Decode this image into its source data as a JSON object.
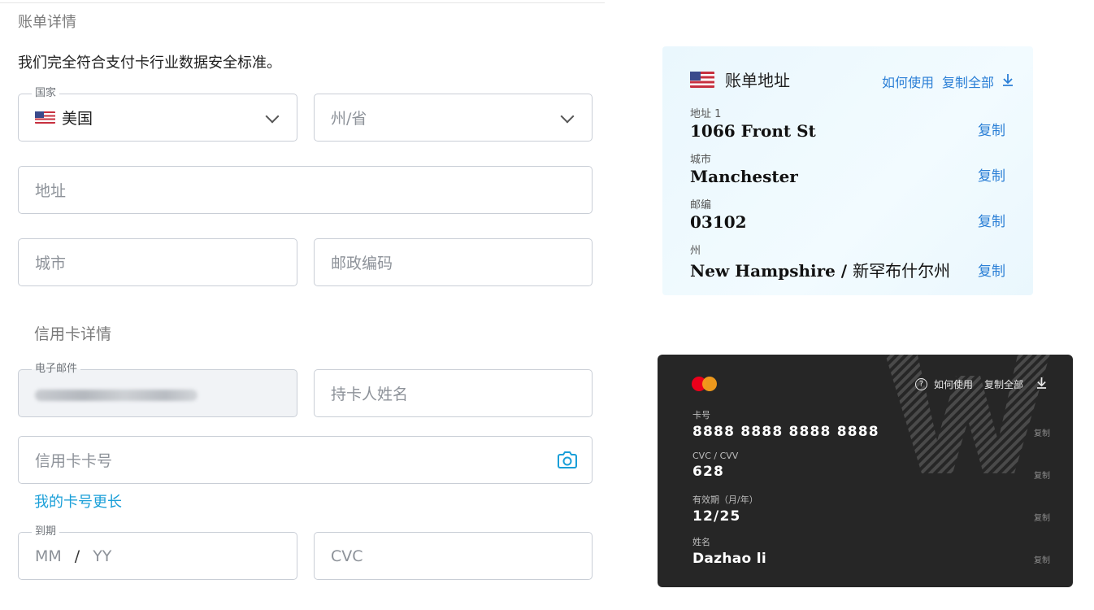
{
  "form": {
    "section_title": "账单详情",
    "subtitle": "我们完全符合支付卡行业数据安全标准。",
    "country_label": "国家",
    "country_value": "美国",
    "state_placeholder": "州/省",
    "address_placeholder": "地址",
    "city_placeholder": "城市",
    "postal_placeholder": "邮政编码",
    "cc_section_title": "信用卡详情",
    "email_label": "电子邮件",
    "cardholder_placeholder": "持卡人姓名",
    "card_number_placeholder": "信用卡卡号",
    "longer_card_link": "我的卡号更长",
    "expiry_label": "到期",
    "expiry_mm": "MM",
    "expiry_sep": "/",
    "expiry_yy": "YY",
    "cvc_placeholder": "CVC"
  },
  "address_card": {
    "title": "账单地址",
    "how_to_use": "如何使用",
    "copy_all": "复制全部",
    "download_icon": "download-icon",
    "rows": [
      {
        "label": "地址 1",
        "value": "1066 Front St",
        "copy": "复制"
      },
      {
        "label": "城市",
        "value": "Manchester",
        "copy": "复制"
      },
      {
        "label": "邮编",
        "value": "03102",
        "copy": "复制"
      },
      {
        "label": "州",
        "value": "New Hampshire /",
        "value_cn": "新罕布什尔州",
        "copy": "复制"
      }
    ]
  },
  "credit_card": {
    "how_to_use": "如何使用",
    "copy_all": "复制全部",
    "rows": [
      {
        "label": "卡号",
        "value": "8888 8888 8888 8888",
        "copy": "复制"
      },
      {
        "label": "CVC / CVV",
        "value": "628",
        "copy": "复制"
      },
      {
        "label": "有效期（月/年）",
        "value": "12/25",
        "copy": "复制"
      },
      {
        "label": "姓名",
        "value": "Dazhao li",
        "copy": "复制"
      }
    ]
  },
  "colors": {
    "link_blue": "#1a9fd8",
    "copy_blue": "#2b7fd6",
    "card_dark": "#262626",
    "mastercard_red": "#eb001b",
    "mastercard_orange": "#f79e1b"
  }
}
